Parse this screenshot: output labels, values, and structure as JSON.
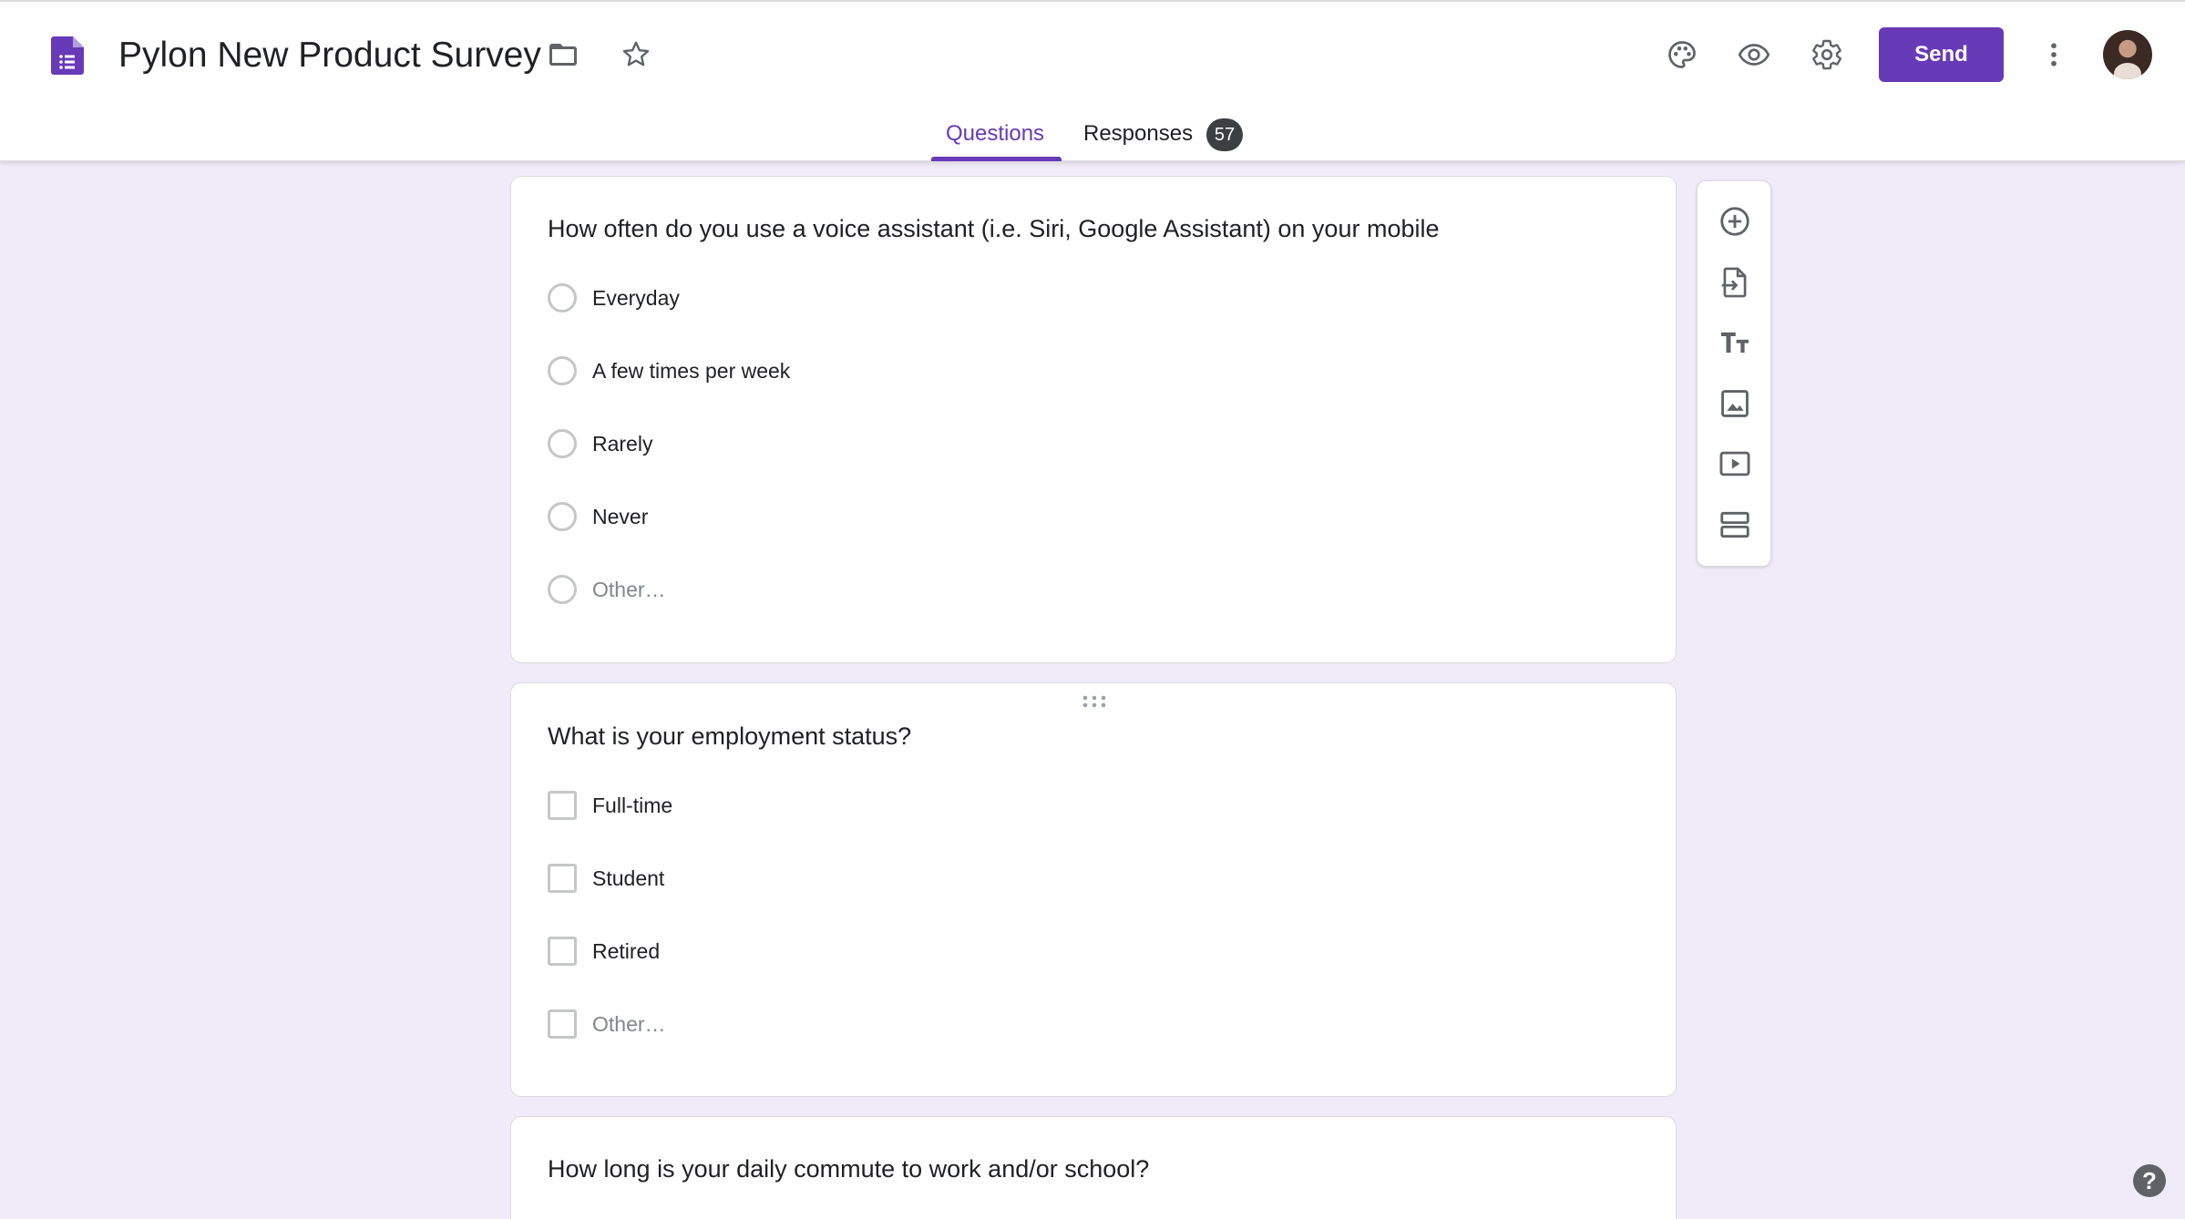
{
  "app": {
    "title": "Pylon New Product Survey",
    "accent_color": "#673ab7",
    "background_color": "#f0ebf8"
  },
  "header": {
    "icons": [
      "forms-logo-icon",
      "folder-icon",
      "star-icon",
      "palette-icon",
      "preview-eye-icon",
      "settings-gear-icon",
      "more-vert-icon",
      "avatar"
    ],
    "send_label": "Send"
  },
  "tabs": {
    "questions_label": "Questions",
    "responses_label": "Responses",
    "responses_count": "57",
    "active": "Questions"
  },
  "questions": [
    {
      "title": "How often do you use a voice assistant (i.e. Siri, Google Assistant) on your mobile",
      "type": "multiple-choice",
      "options": [
        "Everyday",
        "A few times per week",
        "Rarely",
        "Never",
        "Other…"
      ]
    },
    {
      "title": "What is your employment status?",
      "type": "checkboxes",
      "options": [
        "Full-time",
        "Student",
        "Retired",
        "Other…"
      ]
    },
    {
      "title": "How long is your daily commute to work and/or school?",
      "type": "unknown",
      "options": []
    }
  ],
  "toolbar": {
    "items": [
      "add-question-icon",
      "import-questions-icon",
      "add-title-icon",
      "add-image-icon",
      "add-video-icon",
      "add-section-icon"
    ]
  },
  "help": {
    "label": "?"
  }
}
